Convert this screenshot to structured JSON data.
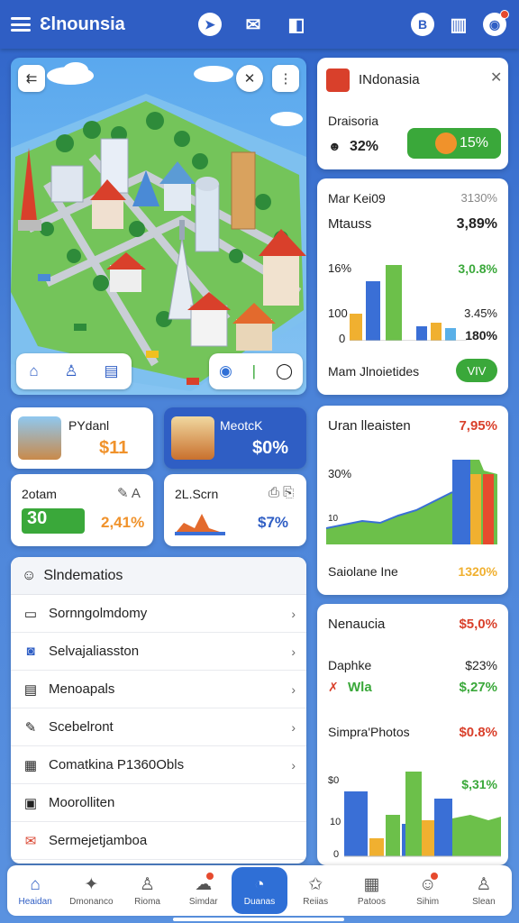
{
  "topbar": {
    "title": "Ɛlnounsia"
  },
  "map": {
    "back_icon": "⇇",
    "close_icon": "✕",
    "more_icon": "⋮"
  },
  "card_indonesia": {
    "title": "INdonasia",
    "label": "Draisoria",
    "percent": "32%",
    "progress_label": "15%",
    "progress": 0.15
  },
  "card_stats": {
    "title": "Mar Kei09",
    "title_value": "3130%",
    "metric_label": "Mtauss",
    "metric_value": "3,89%",
    "y_top": "16%",
    "y_mid": "100",
    "y_zero": "0",
    "right_top": "3,0.8%",
    "right_mid": "3.45%",
    "right_low": "180%",
    "footer_label": "Mam Jlnoietides",
    "footer_badge": "VIV"
  },
  "card_trend": {
    "title": "Uran lleaisten",
    "title_value": "7,95%",
    "y_label": "30%",
    "y_zero": "10",
    "footer_label": "Saiolane Ine",
    "footer_value": "1320%"
  },
  "card_nenaucia": {
    "title": "Nenaucia",
    "title_value": "$5,0%",
    "row1_label": "Daphke",
    "row1_value": "$23%",
    "row2_label": "Wla",
    "row2_value": "$,27%",
    "row3_label": "Simpra'Photos",
    "row3_value": "$0.8%",
    "chart_value": "$,31%",
    "y_top": "$0",
    "y_mid": "10",
    "y_zero": "0"
  },
  "tiles": {
    "tile1_title": "PYdanl",
    "tile1_value": "$11",
    "tile2_title": "MeotcK",
    "tile2_value": "$0%",
    "tile3_title": "2otam",
    "tile3_badge": "30",
    "tile3_value": "2,41%",
    "tile4_title": "2L.Scrn",
    "tile4_value": "$7%"
  },
  "list": {
    "header": "Slndematios",
    "items": [
      {
        "label": "Sornngolmdomy"
      },
      {
        "label": "Selvajaliasston"
      },
      {
        "label": "Menoapals"
      },
      {
        "label": "Scebelront"
      },
      {
        "label": "Comatkina P1360Obls"
      },
      {
        "label": "Moorolliten"
      },
      {
        "label": "Sermejetjamboa"
      }
    ]
  },
  "nav": {
    "items": [
      {
        "label": "Heaidan"
      },
      {
        "label": "Dmonanco"
      },
      {
        "label": "Rioma"
      },
      {
        "label": "Simdar"
      },
      {
        "label": "Duanas"
      },
      {
        "label": "Reiias"
      },
      {
        "label": "Patoos"
      },
      {
        "label": "Sihim"
      },
      {
        "label": "Slean"
      }
    ]
  },
  "colors": {
    "brand": "#2f5ec4",
    "green": "#3aa83a",
    "red": "#d9402b",
    "orange": "#f0922b"
  }
}
